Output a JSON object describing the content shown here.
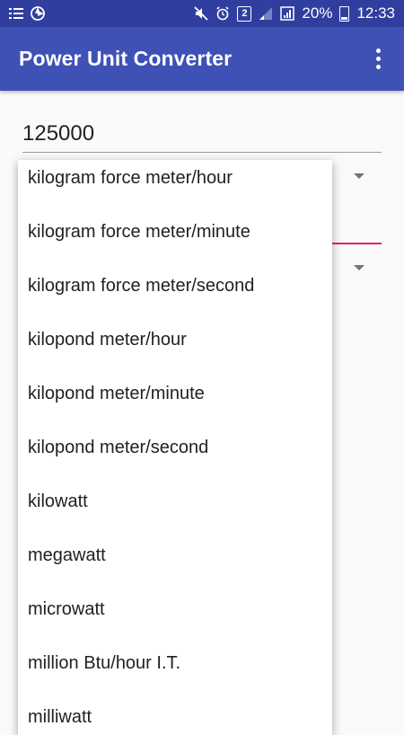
{
  "status_bar": {
    "left_icons": [
      "list-notification-icon",
      "shutter-icon"
    ],
    "badge": "2",
    "battery": "20%",
    "time": "12:33"
  },
  "app_bar": {
    "title": "Power Unit Converter"
  },
  "input": {
    "value": "125000"
  },
  "dropdown": {
    "items": [
      "kilogram force meter/hour",
      "kilogram force meter/minute",
      "kilogram force meter/second",
      "kilopond meter/hour",
      "kilopond meter/minute",
      "kilopond meter/second",
      "kilowatt",
      "megawatt",
      "microwatt",
      "million Btu/hour I.T.",
      "milliwatt"
    ]
  },
  "colors": {
    "status_bar": "#303f9f",
    "app_bar": "#3f51b5",
    "accent": "#e91e63"
  }
}
